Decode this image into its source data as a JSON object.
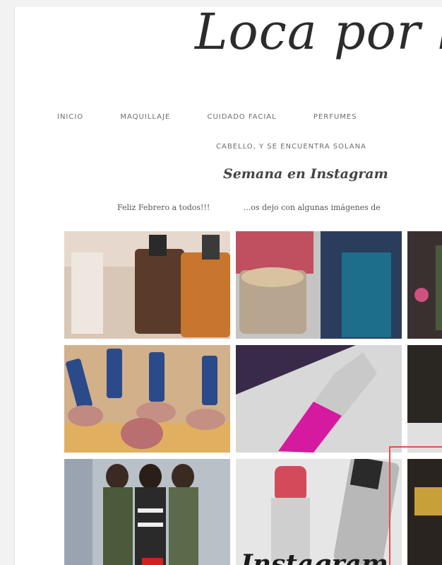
{
  "blog": {
    "title": "Loca por l"
  },
  "nav": {
    "items": [
      "INICIO",
      "MAQUILLAJE",
      "CUIDADO FACIAL",
      "PERFUMES"
    ],
    "row2": "CABELLO, Y SE ENCUENTRA SOLANA"
  },
  "post": {
    "title": "Semana en Instagram",
    "link_left": "Feliz Febrero a todos!!!",
    "link_right": "...os dejo con algunas imágenes de"
  },
  "gallery": {
    "overlay_label": "Instagram"
  },
  "colors": {
    "page_bg": "#ffffff",
    "outer_bg": "#f2f2f2",
    "highlight_box": "#e05050"
  }
}
